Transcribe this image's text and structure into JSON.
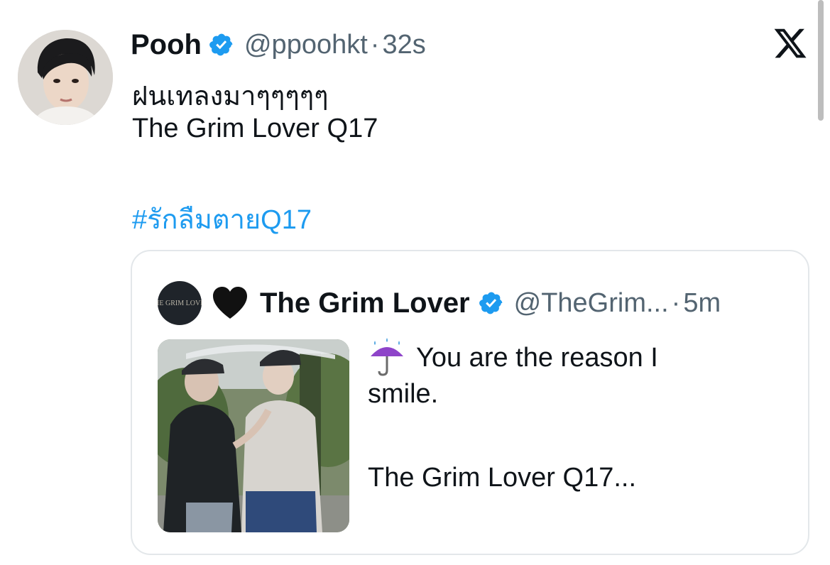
{
  "author": {
    "display_name": "Pooh",
    "handle": "@ppoohkt",
    "separator": "·",
    "time": "32s",
    "verified": true,
    "avatar_icon": "profile-photo"
  },
  "tweet": {
    "line1": "ฝนเทลงมาๆๆๆๆๆ",
    "line2": "The Grim Lover Q17",
    "hashtag": "#รักลืมตายQ17"
  },
  "quoted": {
    "avatar_text": "THE GRIM LOVER",
    "heart": "🖤",
    "display_name": "The Grim Lover",
    "handle": "@TheGrim...",
    "separator": "·",
    "time": "5m",
    "verified": true,
    "emoji_icon": "umbrella-rain-icon",
    "line1": "You are the reason I",
    "line2": "smile.",
    "line3": "The Grim Lover Q17..."
  },
  "colors": {
    "text": "#0f1419",
    "secondary": "#536471",
    "link": "#1d9bf0",
    "verified_badge": "#1d9bf0",
    "border": "#e3e7ea"
  },
  "icons": {
    "brand": "x-logo-icon",
    "verified": "verified-badge-icon"
  }
}
